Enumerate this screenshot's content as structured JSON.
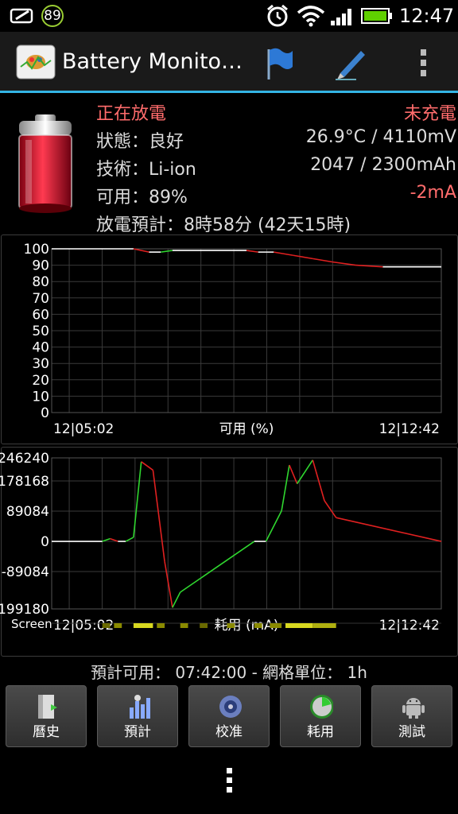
{
  "status_bar": {
    "notification_count": "89",
    "time": "12:47",
    "battery_color": "#5fd000"
  },
  "action_bar": {
    "title": "Battery Monito…",
    "accent_color": "#33b5e5",
    "icons": [
      "app-icon",
      "flag-icon",
      "pencil-icon",
      "overflow-menu-icon"
    ]
  },
  "info": {
    "status_left": "正在放電",
    "status_right": "未充電",
    "health": "狀態：良好",
    "temp_voltage": "26.9°C / 4110mV",
    "tech": "技術：Li-ion",
    "capacity": "2047 / 2300mAh",
    "level": "可用：89%",
    "current": "-2mA",
    "estimate": "放電預計：8時58分 (42天15時)"
  },
  "chart_data": [
    {
      "type": "line",
      "title": "",
      "xlabel": "可用 (%)",
      "x_start": "12|05:02",
      "x_end": "12|12:42",
      "ylim": [
        0,
        100
      ],
      "y_ticks": [
        "100",
        "90",
        "80",
        "70",
        "60",
        "50",
        "40",
        "30",
        "20",
        "10",
        "0"
      ],
      "grid": true,
      "x": [
        0,
        0.21,
        0.25,
        0.28,
        0.31,
        0.45,
        0.5,
        0.53,
        0.57,
        0.62,
        0.67,
        0.72,
        0.78,
        0.85,
        1.0
      ],
      "values": [
        100,
        100,
        98,
        98,
        99,
        99,
        99,
        98,
        98,
        96,
        94,
        92,
        90,
        89,
        89
      ]
    },
    {
      "type": "line",
      "title": "",
      "xlabel": "耗用 (mA)",
      "x_start": "12|05:02",
      "x_end": "12|12:42",
      "ylim": [
        -199180,
        246240
      ],
      "y_ticks": [
        "246240",
        "178168",
        "89084",
        "0",
        "-89084",
        "-199180"
      ],
      "grid": true,
      "row_label": "Screen",
      "x": [
        0,
        0.13,
        0.15,
        0.17,
        0.19,
        0.21,
        0.23,
        0.26,
        0.29,
        0.31,
        0.33,
        0.52,
        0.55,
        0.59,
        0.61,
        0.63,
        0.67,
        0.7,
        0.73,
        1.0
      ],
      "values": [
        0,
        0,
        8000,
        0,
        0,
        12000,
        235000,
        210000,
        -60000,
        -195000,
        -150000,
        0,
        0,
        90000,
        225000,
        170000,
        240000,
        120000,
        70000,
        0
      ]
    }
  ],
  "bottom": {
    "predict_text": "預計可用： 07:42:00 - 網格單位： 1h",
    "tabs": [
      "曆史",
      "預計",
      "校准",
      "耗用",
      "測試"
    ]
  }
}
